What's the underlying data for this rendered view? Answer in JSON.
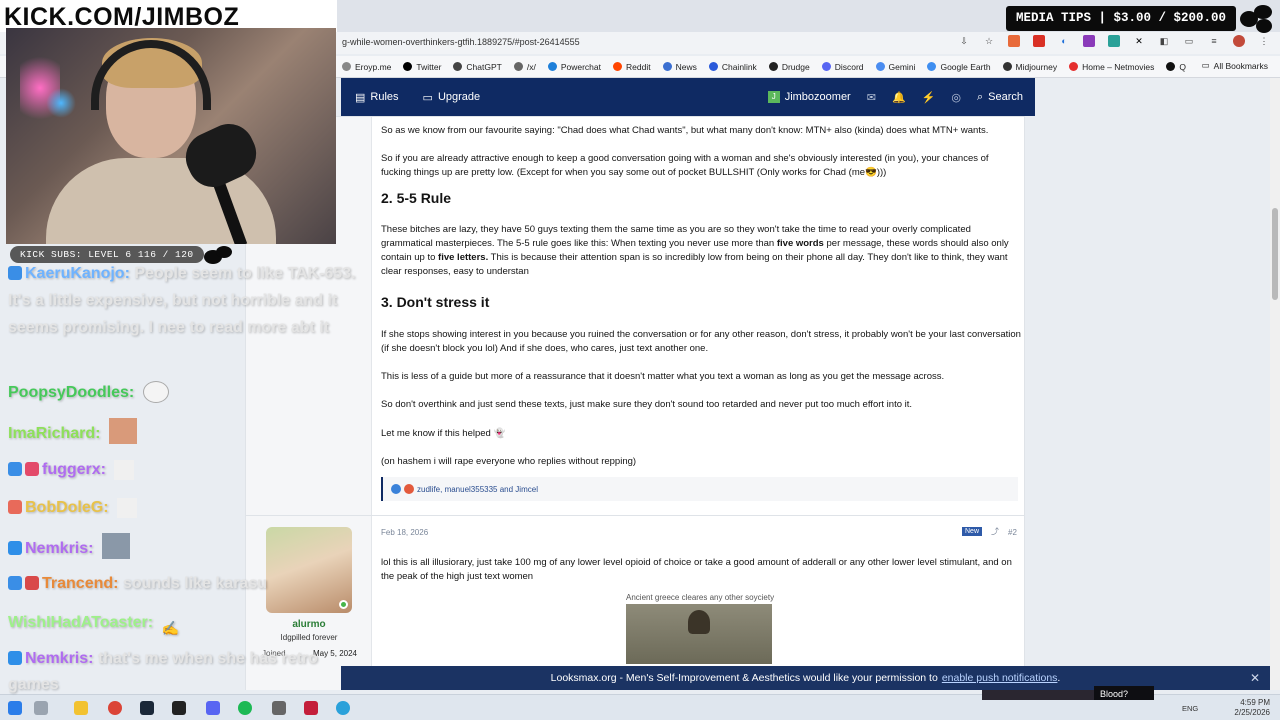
{
  "stream": {
    "kick_title": "KICK.COM/JIMBOZ",
    "subs_label": "KICK SUBS: LEVEL 6 116 / 120",
    "media_tips": "MEDIA TIPS | $3.00 / $200.00"
  },
  "browser": {
    "url": "g-while-women-overthinkers-gtfih.1889275/#post-26414555",
    "bookmarks": [
      {
        "label": "Eroyp.me",
        "color": "#888888"
      },
      {
        "label": "Twitter",
        "color": "#000000"
      },
      {
        "label": "ChatGPT",
        "color": "#444444"
      },
      {
        "label": "/x/",
        "color": "#666666"
      },
      {
        "label": "Powerchat",
        "color": "#1e7fd9"
      },
      {
        "label": "Reddit",
        "color": "#ff4500"
      },
      {
        "label": "News",
        "color": "#3b6fd1"
      },
      {
        "label": "Chainlink",
        "color": "#2a5ada"
      },
      {
        "label": "Drudge",
        "color": "#222222"
      },
      {
        "label": "Discord",
        "color": "#5865f2"
      },
      {
        "label": "Gemini",
        "color": "#4a8cf0"
      },
      {
        "label": "Google Earth",
        "color": "#3f8ef0"
      },
      {
        "label": "Midjourney",
        "color": "#333333"
      },
      {
        "label": "Home – Netmovies",
        "color": "#e52e2e"
      },
      {
        "label": "Q",
        "color": "#111111"
      }
    ],
    "all_bookmarks": "All Bookmarks"
  },
  "forum_nav": {
    "rules": "Rules",
    "upgrade": "Upgrade",
    "username": "Jimbozoomer",
    "search": "Search"
  },
  "post1": {
    "p1": "So as we know from our favourite saying: \"Chad does what Chad wants\", but what many don't know: MTN+ also (kinda) does what MTN+ wants.",
    "p2": "So if you are already attractive enough to keep a good conversation going with a woman and she's obviously interested (in you), your chances of fucking things up are pretty low. (Except for when you say some out of pocket BULLSHIT (Only works for Chad (me😎)))",
    "h_55": "2. 5-5 Rule",
    "p3a": "These bitches are lazy, they have 50 guys texting them the same time as you are so they won't take the time to read your overly complicated grammatical masterpieces. The 5-5 rule goes like this: When texting you never use more than ",
    "p3b": "five words",
    "p3c": " per message, these words should also only contain up to ",
    "p3d": "five letters.",
    "p3e": " This is because their attention span is so incredibly low from being on their phone all day. They don't like to think, they want clear responses, easy to understan",
    "h_stress": "3. Don't stress it",
    "p4": "If she stops showing interest in you because you ruined the conversation or for any other reason, don't stress, it probably won't be your last conversation (if she doesn't block you lol) And if she does, who cares, just text another one.",
    "p5": "This is less of a guide but more of a reassurance that it doesn't matter what you text a woman as long as you get the message across.",
    "p6": "So don't overthink and just send these texts, just make sure they don't sound too retarded and never put too much effort into it.",
    "p7": "Let me know if this helped",
    "p8": "(on hashem i will rape everyone who replies without repping)",
    "reactions": "zudlife, manuel355335 and Jimcel"
  },
  "post2": {
    "date": "Feb 18, 2026",
    "new_badge": "New",
    "number": "#2",
    "username": "alurmo",
    "user_title": "Idgpilled forever",
    "join_label": "Joined",
    "join_date": "May 5, 2024",
    "text": "lol this is all illusiorary, just take 100 mg of any lower level opioid of choice or take a good amount of adderall or any other lower level stimulant, and on the peak of the high just text women",
    "image_caption": "Ancient greece cleares any other soyciety"
  },
  "notification": {
    "text": "Looksmax.org - Men's Self-Improvement & Aesthetics would like your permission to",
    "link": "enable push notifications",
    "suffix": "."
  },
  "chat": [
    {
      "user": "KaeruKanojo:",
      "user_color": "#6fb3ff",
      "msg": "People seem to like TAK-653. It's a little expensive, but not horrible and it seems promising. I nee to read more abt it",
      "badge_color": "#3a8ee6"
    },
    {
      "user": "PoopsyDoodles:",
      "user_color": "#46c95a",
      "msg": "",
      "badge_color": ""
    },
    {
      "user": "ImaRichard:",
      "user_color": "#8ee05a",
      "msg": "",
      "badge_color": ""
    },
    {
      "user": "fuggerx:",
      "user_color": "#b06cf0",
      "msg": "",
      "badge_color": "#e34a6a"
    },
    {
      "user": "BobDoleG:",
      "user_color": "#e8c24a",
      "msg": "",
      "badge_color": "#e86a5a"
    },
    {
      "user": "Nemkris:",
      "user_color": "#b06cf0",
      "msg": "",
      "badge_color": "#2f8fe8"
    },
    {
      "user": "Trancend:",
      "user_color": "#e88a3a",
      "msg": "sounds like karasu",
      "badge_color": "#3a8ee6"
    },
    {
      "user": "WishIHadAToaster:",
      "user_color": "#9ef08a",
      "msg": "",
      "badge_color": ""
    },
    {
      "user": "Nemkris:",
      "user_color": "#b06cf0",
      "msg": "that's me when she has retro games",
      "badge_color": "#2f8fe8"
    }
  ],
  "taskbar": {
    "lang": "ENG",
    "time": "4:59 PM",
    "date": "2/25/2026",
    "overlay_text": "Blood?"
  }
}
